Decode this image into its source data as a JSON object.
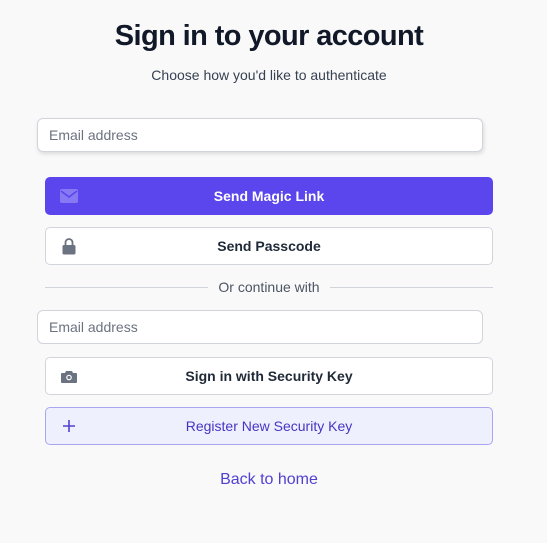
{
  "header": {
    "title": "Sign in to your account",
    "subtitle": "Choose how you'd like to authenticate"
  },
  "magic_link": {
    "email_placeholder": "Email address",
    "email_value": "",
    "send_magic_link_label": "Send Magic Link",
    "send_magic_link_icon": "envelope-icon",
    "send_passcode_label": "Send Passcode",
    "send_passcode_icon": "lock-icon"
  },
  "divider": {
    "label": "Or continue with"
  },
  "security_key": {
    "email_placeholder": "Email address",
    "email_value": "",
    "sign_in_label": "Sign in with Security Key",
    "sign_in_icon": "camera-icon",
    "register_label": "Register New Security Key",
    "register_icon": "plus-icon"
  },
  "footer": {
    "back_link_label": "Back to home"
  },
  "colors": {
    "primary": "#5b45ec",
    "background": "#f9f9fa",
    "register_bg": "#eef0fe",
    "link": "#5041d0"
  }
}
